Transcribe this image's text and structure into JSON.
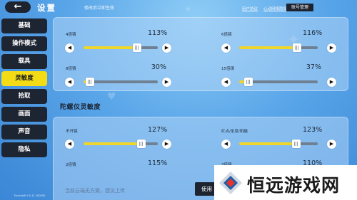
{
  "header": {
    "back_icon": "back-arrow-icon",
    "back_glyph": "←",
    "title": "设置",
    "hint": "修改后立即生效",
    "links": [
      "用户协议",
      "心动网络隐私政策"
    ],
    "account_button": "账号管理"
  },
  "sidebar": {
    "items": [
      {
        "label": "基础",
        "active": false
      },
      {
        "label": "操作模式",
        "active": false
      },
      {
        "label": "载具",
        "active": false
      },
      {
        "label": "灵敏度",
        "active": true
      },
      {
        "label": "拾取",
        "active": false
      },
      {
        "label": "画面",
        "active": false
      },
      {
        "label": "声音",
        "active": false
      },
      {
        "label": "隐私",
        "active": false
      }
    ],
    "version": "ExcludeFr.1.0.11.100050"
  },
  "scope_sliders": [
    {
      "label": "4倍镜",
      "value": "113%",
      "level": 0.72
    },
    {
      "label": "6倍镜",
      "value": "116%",
      "level": 0.74
    },
    {
      "label": "8倍镜",
      "value": "30%",
      "level": 0.09
    },
    {
      "label": "15倍镜",
      "value": "37%",
      "level": 0.12
    }
  ],
  "gyro": {
    "title": "陀螺仪灵敏度",
    "sliders": [
      {
        "label": "不开镜",
        "value": "127%",
        "level": 0.78
      },
      {
        "label": "红点/全息/机瞄",
        "value": "123%",
        "level": 0.73
      },
      {
        "label": "2倍镜",
        "value": "115%",
        "level": null
      },
      {
        "label": "3倍镜",
        "value": "110%",
        "level": null
      }
    ]
  },
  "cloud_tip": "当前云端无方案，建议上传",
  "use_button": "使用",
  "arrows": {
    "left_icon": "chevron-left-icon",
    "left_glyph": "◀",
    "right_icon": "chevron-right-icon",
    "right_glyph": "▶"
  },
  "watermark": {
    "text": "恒远游戏网"
  },
  "colors": {
    "accent": "#f3dc15",
    "dark": "#1d2430",
    "track": "#6f8092",
    "background": "#5aa6e9"
  }
}
